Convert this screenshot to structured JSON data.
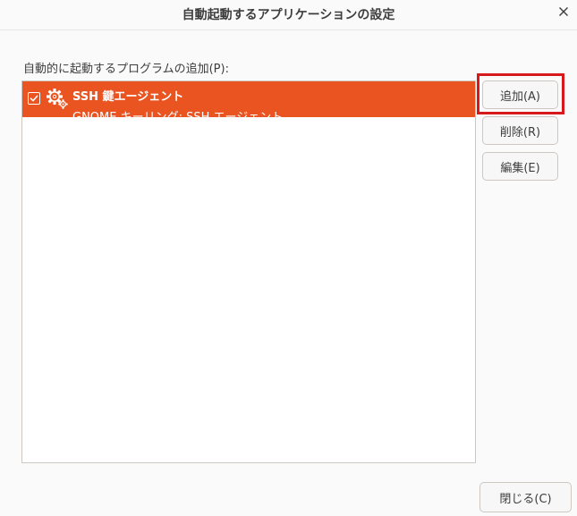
{
  "window": {
    "title": "自動起動するアプリケーションの設定",
    "close_icon": "close-icon"
  },
  "program_list": {
    "label": "自動的に起動するプログラムの追加(P):",
    "items": [
      {
        "checked": true,
        "icon": "gears-icon",
        "name": "SSH 鍵エージェント",
        "description": "GNOME キーリング: SSH エージェント",
        "selected": true
      }
    ]
  },
  "actions": {
    "add_label": "追加(A)",
    "remove_label": "削除(R)",
    "edit_label": "編集(E)",
    "close_label": "閉じる(C)"
  },
  "colors": {
    "selection": "#e95420",
    "highlight_annotation": "#d7191c",
    "background": "#fafafa"
  }
}
